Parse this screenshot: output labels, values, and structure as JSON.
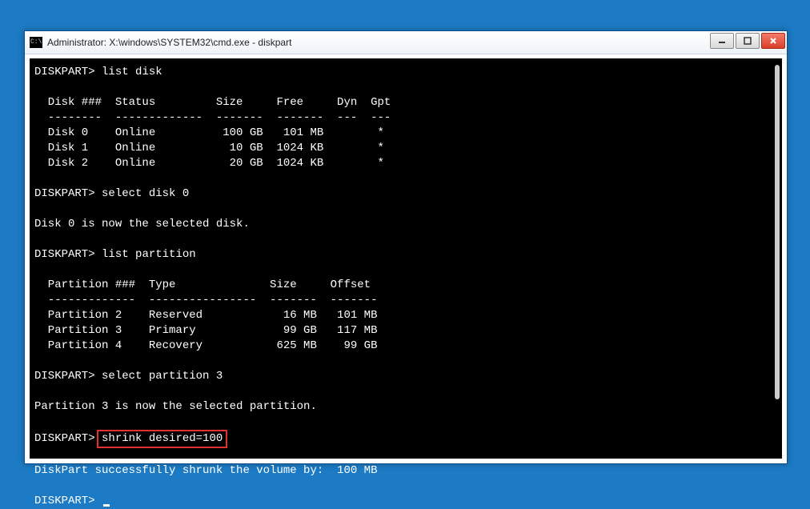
{
  "window": {
    "title": "Administrator: X:\\windows\\SYSTEM32\\cmd.exe - diskpart"
  },
  "prompt": "DISKPART>",
  "cmds": {
    "listDisk": "list disk",
    "selDisk": "select disk 0",
    "listPart": "list partition",
    "selPart": "select partition 3",
    "shrink": "shrink desired=100"
  },
  "diskHeader": "  Disk ###  Status         Size     Free     Dyn  Gpt",
  "diskDivider": "  --------  -------------  -------  -------  ---  ---",
  "disks": [
    "  Disk 0    Online          100 GB   101 MB        *",
    "  Disk 1    Online           10 GB  1024 KB        *",
    "  Disk 2    Online           20 GB  1024 KB        *"
  ],
  "msgSelDisk": "Disk 0 is now the selected disk.",
  "partHeader": "  Partition ###  Type              Size     Offset",
  "partDivider": "  -------------  ----------------  -------  -------",
  "parts": [
    "  Partition 2    Reserved            16 MB   101 MB",
    "  Partition 3    Primary             99 GB   117 MB",
    "  Partition 4    Recovery           625 MB    99 GB"
  ],
  "msgSelPart": "Partition 3 is now the selected partition.",
  "msgShrunk": "DiskPart successfully shrunk the volume by:  100 MB"
}
